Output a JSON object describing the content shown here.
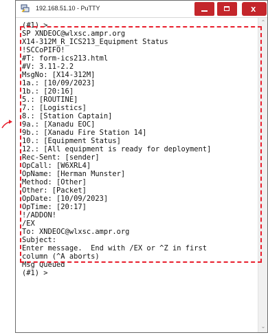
{
  "window": {
    "title": "192.168.51.10 - PuTTY",
    "close_label": "x"
  },
  "colors": {
    "accent": "#c4262b",
    "highlight": "#e81d2b"
  },
  "terminal": {
    "lines": [
      "(#1) >",
      "SP XNDEOC@wlxsc.ampr.org",
      "X14-312M_R_ICS213_Equipment Status",
      "!SCCoPIFO!",
      "#T: form-ics213.html",
      "#V: 3.11-2.2",
      "MsgNo: [X14-312M]",
      "1a.: [10/09/2023]",
      "1b.: [20:16]",
      "5.: [ROUTINE]",
      "7.: [Logistics]",
      "8.: [Station Captain]",
      "9a.: [Xanadu EOC]",
      "9b.: [Xanadu Fire Station 14]",
      "10.: [Equipment Status]",
      "12.: [All equipment is ready for deployment]",
      "Rec-Sent: [sender]",
      "OpCall: [W6XRL4]",
      "OpName: [Herman Munster]",
      "Method: [Other]",
      "Other: [Packet]",
      "OpDate: [10/09/2023]",
      "OpTime: [20:17]",
      "!/ADDON!",
      "/EX",
      "To: XNDEOC@wlxsc.ampr.org",
      "Subject:",
      "Enter message.  End with /EX or ^Z in first",
      "column (^A aborts)",
      "Msg Queued",
      "(#1) >"
    ]
  }
}
